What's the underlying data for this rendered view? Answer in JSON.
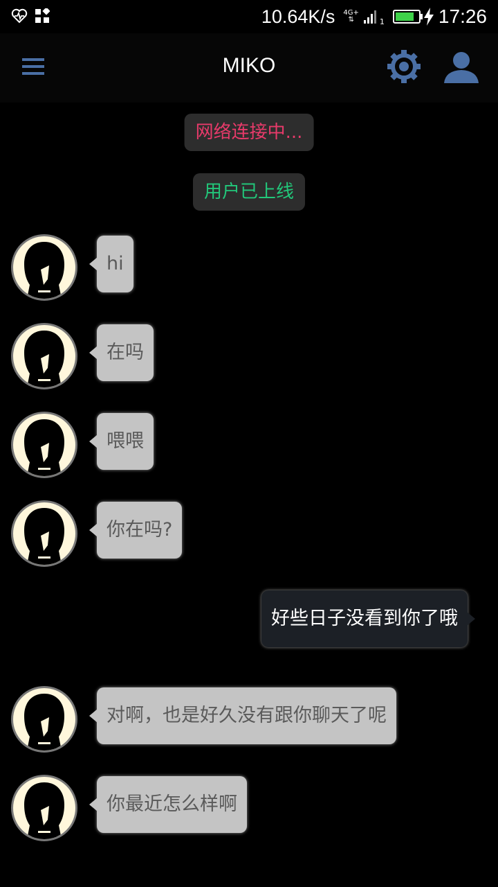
{
  "status_bar": {
    "net_speed": "10.64K/s",
    "network_type": "4G+",
    "sim_slot": "1",
    "time": "17:26",
    "icons": [
      "heart-monitor-icon",
      "apps-grid-icon",
      "signal-icon",
      "battery-icon",
      "charging-icon"
    ]
  },
  "app_bar": {
    "title": "MIKO",
    "icons": [
      "menu-icon",
      "gear-icon",
      "user-icon"
    ],
    "accent_color": "#4a6fa5"
  },
  "system_messages": {
    "connecting": "网络连接中...",
    "online": "用户已上线"
  },
  "messages": [
    {
      "from": "other",
      "text": "hi"
    },
    {
      "from": "other",
      "text": "在吗"
    },
    {
      "from": "other",
      "text": "喂喂"
    },
    {
      "from": "other",
      "text": "你在吗?"
    },
    {
      "from": "me",
      "text": "好些日子没看到你了哦"
    },
    {
      "from": "other",
      "text": "对啊，也是好久没有跟你聊天了呢"
    },
    {
      "from": "other",
      "text": "你最近怎么样啊"
    }
  ],
  "colors": {
    "connecting_text": "#e83a6a",
    "online_text": "#22c77a",
    "incoming_bubble": "#c4c4c4",
    "outgoing_bubble": "#1c2026"
  }
}
